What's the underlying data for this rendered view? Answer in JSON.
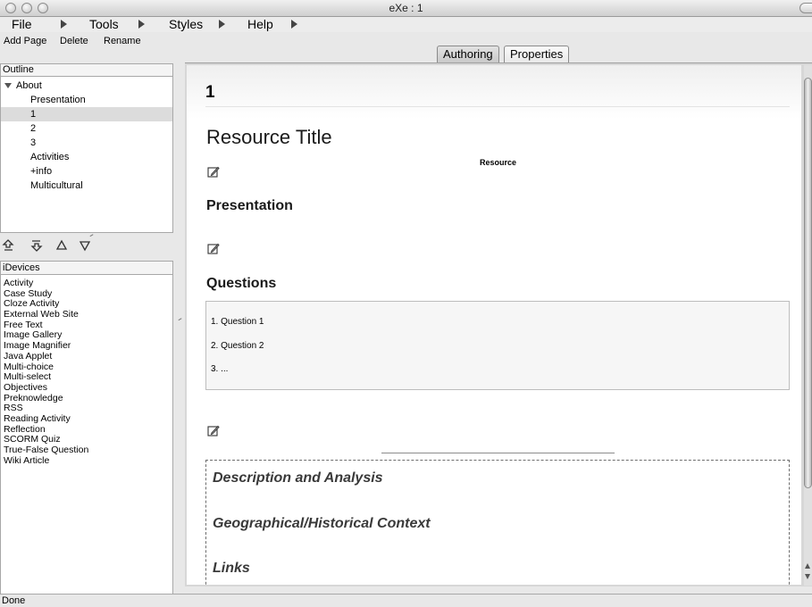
{
  "window": {
    "title": "eXe : 1"
  },
  "menu": [
    {
      "label": "File"
    },
    {
      "label": "Tools"
    },
    {
      "label": "Styles"
    },
    {
      "label": "Help"
    }
  ],
  "outline_toolbar": {
    "add_page": "Add Page",
    "delete": "Delete",
    "rename": "Rename"
  },
  "outline": {
    "header": "Outline",
    "items": [
      {
        "label": "About",
        "expanded": true
      },
      {
        "label": "Presentation"
      },
      {
        "label": "1",
        "selected": true
      },
      {
        "label": "2"
      },
      {
        "label": "3"
      },
      {
        "label": "Activities"
      },
      {
        "label": "+info"
      },
      {
        "label": "Multicultural"
      }
    ],
    "move_buttons": [
      "promote-icon",
      "demote-icon",
      "move-up-icon",
      "move-down-icon"
    ]
  },
  "idevices": {
    "header": "iDevices",
    "items": [
      "Activity",
      "Case Study",
      "Cloze Activity",
      "External Web Site",
      "Free Text",
      "Image Gallery",
      "Image Magnifier",
      "Java Applet",
      "Multi-choice",
      "Multi-select",
      "Objectives",
      "Preknowledge",
      "RSS",
      "Reading Activity",
      "Reflection",
      "SCORM Quiz",
      "True-False Question",
      "Wiki Article"
    ]
  },
  "tabs": [
    {
      "label": "Authoring",
      "active": true
    },
    {
      "label": "Properties",
      "active": false
    }
  ],
  "page": {
    "number": "1",
    "resource_title": "Resource Title",
    "resource_tag": "Resource",
    "presentation_heading": "Presentation",
    "questions_heading": "Questions",
    "questions": [
      "1. Question 1",
      "2. Question 2",
      "3. ..."
    ],
    "analysis_headings": [
      "Description and Analysis",
      "Geographical/Historical Context",
      "Links"
    ]
  },
  "status": {
    "text": "Done"
  }
}
